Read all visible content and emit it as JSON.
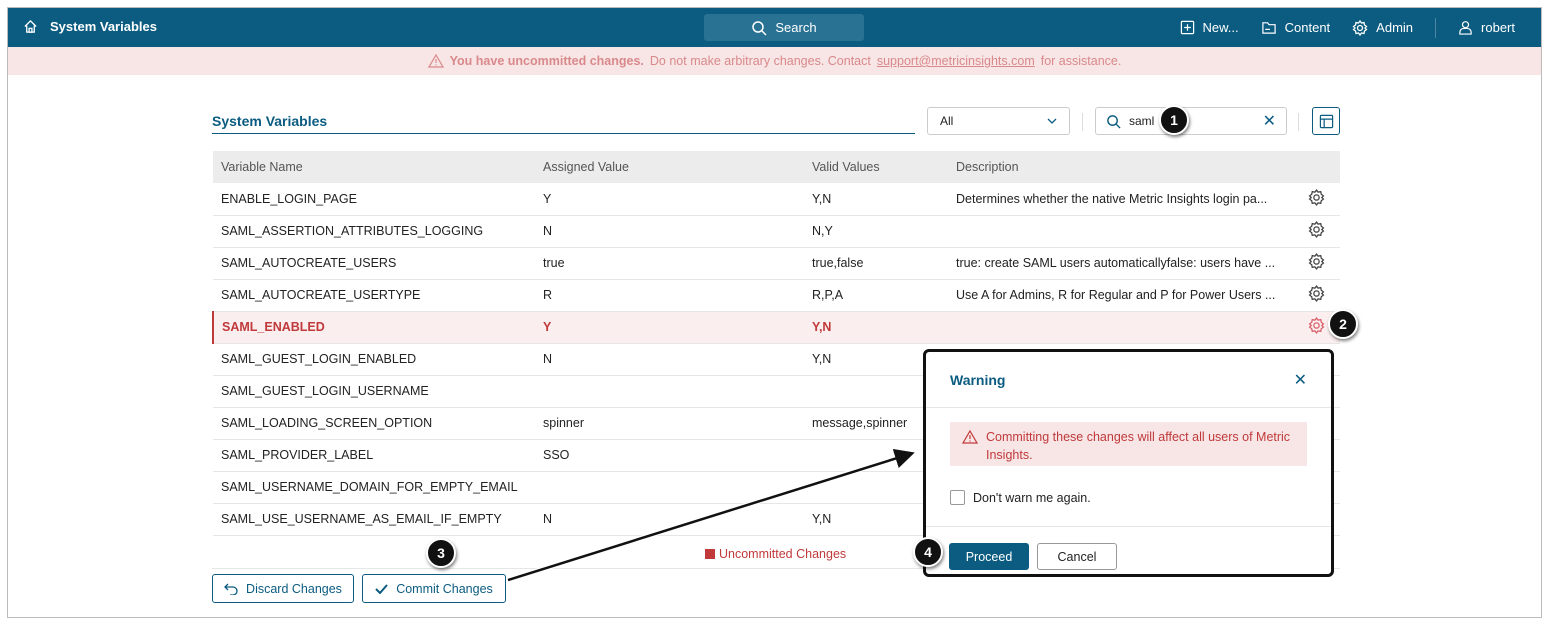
{
  "topbar": {
    "title": "System Variables",
    "search": "Search",
    "new": "New...",
    "content": "Content",
    "admin": "Admin",
    "user": "robert"
  },
  "banner": {
    "bold": "You have uncommitted changes.",
    "text": "Do not make arbitrary changes. Contact",
    "link": "support@metricinsights.com",
    "tail": "for assistance."
  },
  "page": {
    "title": "System Variables",
    "filter": "All",
    "search_value": "saml"
  },
  "table": {
    "headers": [
      "Variable Name",
      "Assigned Value",
      "Valid Values",
      "Description"
    ],
    "rows": [
      {
        "name": "ENABLE_LOGIN_PAGE",
        "value": "Y",
        "valid": "Y,N",
        "desc": "Determines whether the native Metric Insights login pa..."
      },
      {
        "name": "SAML_ASSERTION_ATTRIBUTES_LOGGING",
        "value": "N",
        "valid": "N,Y",
        "desc": ""
      },
      {
        "name": "SAML_AUTOCREATE_USERS",
        "value": "true",
        "valid": "true,false",
        "desc": "true: create SAML users automaticallyfalse: users have ..."
      },
      {
        "name": "SAML_AUTOCREATE_USERTYPE",
        "value": "R",
        "valid": "R,P,A",
        "desc": "Use A for Admins, R for Regular and P for Power Users ..."
      },
      {
        "name": "SAML_ENABLED",
        "value": "Y",
        "valid": "Y,N",
        "desc": ""
      },
      {
        "name": "SAML_GUEST_LOGIN_ENABLED",
        "value": "N",
        "valid": "Y,N",
        "desc": ""
      },
      {
        "name": "SAML_GUEST_LOGIN_USERNAME",
        "value": "",
        "valid": "",
        "desc": ""
      },
      {
        "name": "SAML_LOADING_SCREEN_OPTION",
        "value": "spinner",
        "valid": "message,spinner",
        "desc": ""
      },
      {
        "name": "SAML_PROVIDER_LABEL",
        "value": "SSO",
        "valid": "",
        "desc": ""
      },
      {
        "name": "SAML_USERNAME_DOMAIN_FOR_EMPTY_EMAIL",
        "value": "",
        "valid": "",
        "desc": ""
      },
      {
        "name": "SAML_USE_USERNAME_AS_EMAIL_IF_EMPTY",
        "value": "N",
        "valid": "Y,N",
        "desc": ""
      }
    ]
  },
  "legend": "Uncommitted Changes",
  "buttons": {
    "discard": "Discard Changes",
    "commit": "Commit Changes"
  },
  "dialog": {
    "title": "Warning",
    "message": "Committing these changes will affect all users of Metric Insights.",
    "checkbox": "Don't warn me again.",
    "proceed": "Proceed",
    "cancel": "Cancel"
  },
  "callouts": [
    "1",
    "2",
    "3",
    "4"
  ],
  "colors": {
    "brand": "#0b5c80",
    "error": "#c0393b",
    "banner_bg": "#f8e5e5"
  }
}
